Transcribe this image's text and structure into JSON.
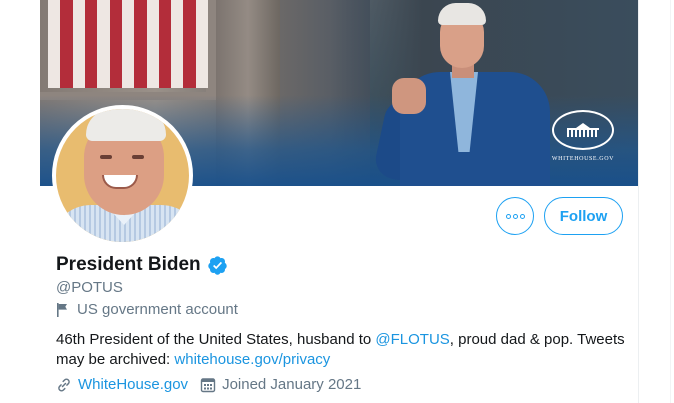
{
  "profile": {
    "display_name": "President Biden",
    "handle": "@POTUS",
    "gov_label": "US government account",
    "bio": {
      "part1": "46th President of the United States, husband to ",
      "mention": "@FLOTUS",
      "part2": ", proud dad & pop. Tweets may be archived: ",
      "link": "whitehouse.gov/privacy"
    },
    "website": "WhiteHouse.gov",
    "joined": "Joined January 2021"
  },
  "banner": {
    "logo_text": "WHITEHOUSE.GOV"
  },
  "actions": {
    "follow_label": "Follow",
    "more_icon": "more-horizontal-icon"
  },
  "colors": {
    "accent": "#1da1f2",
    "link": "#1b95e0",
    "text": "#14171a",
    "muted": "#657786"
  }
}
